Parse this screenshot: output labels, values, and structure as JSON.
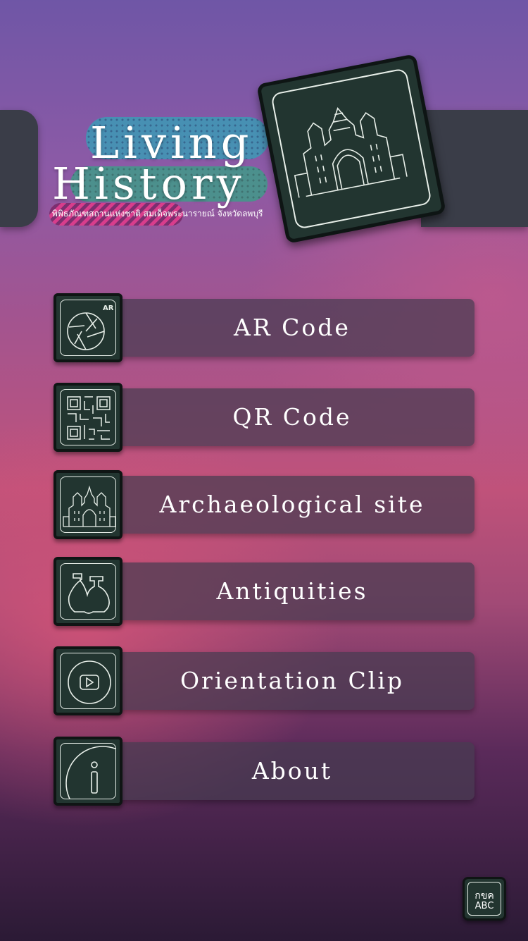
{
  "header": {
    "logo_line1": "Living",
    "logo_line2": "History",
    "logo_subtitle": "พิพิธภัณฑสถานแห่งชาติ สมเด็จพระนารายณ์ จังหวัดลพบุรี",
    "emblem_icon": "palace-gate-icon"
  },
  "menu": [
    {
      "label": "AR Code",
      "icon": "ar-camera-icon"
    },
    {
      "label": "QR Code",
      "icon": "qr-code-icon"
    },
    {
      "label": "Archaeological site",
      "icon": "palace-gate-icon"
    },
    {
      "label": "Antiquities",
      "icon": "pottery-icon"
    },
    {
      "label": "Orientation Clip",
      "icon": "play-icon"
    },
    {
      "label": "About",
      "icon": "info-icon"
    }
  ],
  "ar_badge": "AR",
  "language_button": {
    "line1": "กขค",
    "line2": "ABC",
    "icon": "language-switch-icon"
  },
  "colors": {
    "icon_bg": "#223530",
    "bar_bg": "#463c50",
    "text": "#ffffff"
  }
}
